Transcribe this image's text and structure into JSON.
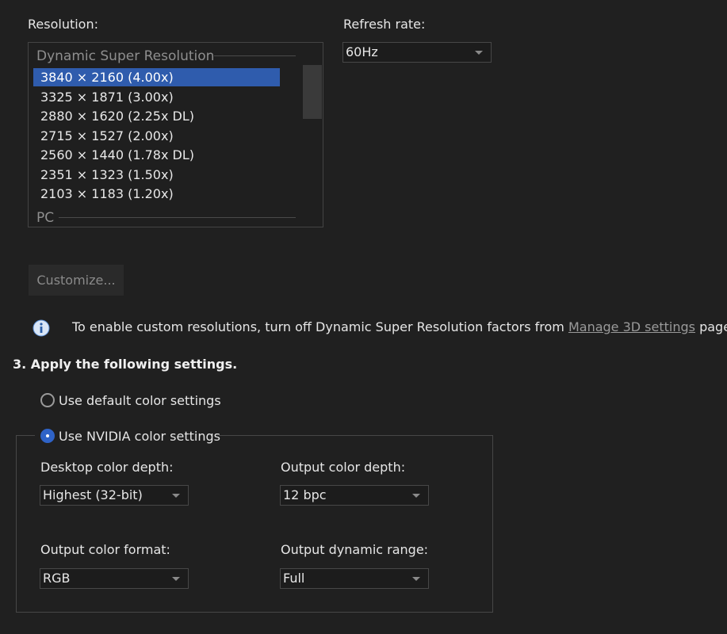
{
  "resolution": {
    "label": "Resolution:",
    "group_dsr": "Dynamic Super Resolution",
    "group_pc": "PC",
    "items": [
      "3840 × 2160 (4.00x)",
      "3325 × 1871 (3.00x)",
      "2880 × 1620 (2.25x DL)",
      "2715 × 1527 (2.00x)",
      "2560 × 1440 (1.78x DL)",
      "2351 × 1323 (1.50x)",
      "2103 × 1183 (1.20x)"
    ],
    "selected_index": 0
  },
  "refresh": {
    "label": "Refresh rate:",
    "value": "60Hz"
  },
  "customize_label": "Customize...",
  "info": {
    "text_before": "To enable custom resolutions, turn off Dynamic Super Resolution factors from ",
    "link": "Manage 3D settings",
    "text_after": " page."
  },
  "section3": {
    "title": "3. Apply the following settings.",
    "radio_default": "Use default color settings",
    "radio_nvidia": "Use NVIDIA color settings",
    "selected": "nvidia"
  },
  "color": {
    "desktop_depth_label": "Desktop color depth:",
    "desktop_depth_value": "Highest (32-bit)",
    "output_depth_label": "Output color depth:",
    "output_depth_value": "12 bpc",
    "format_label": "Output color format:",
    "format_value": "RGB",
    "range_label": "Output dynamic range:",
    "range_value": "Full"
  },
  "colors": {
    "accent": "#2f5cad",
    "background": "#202020"
  },
  "icons": {
    "info": "info-icon",
    "dropdown": "chevron-down-icon"
  }
}
